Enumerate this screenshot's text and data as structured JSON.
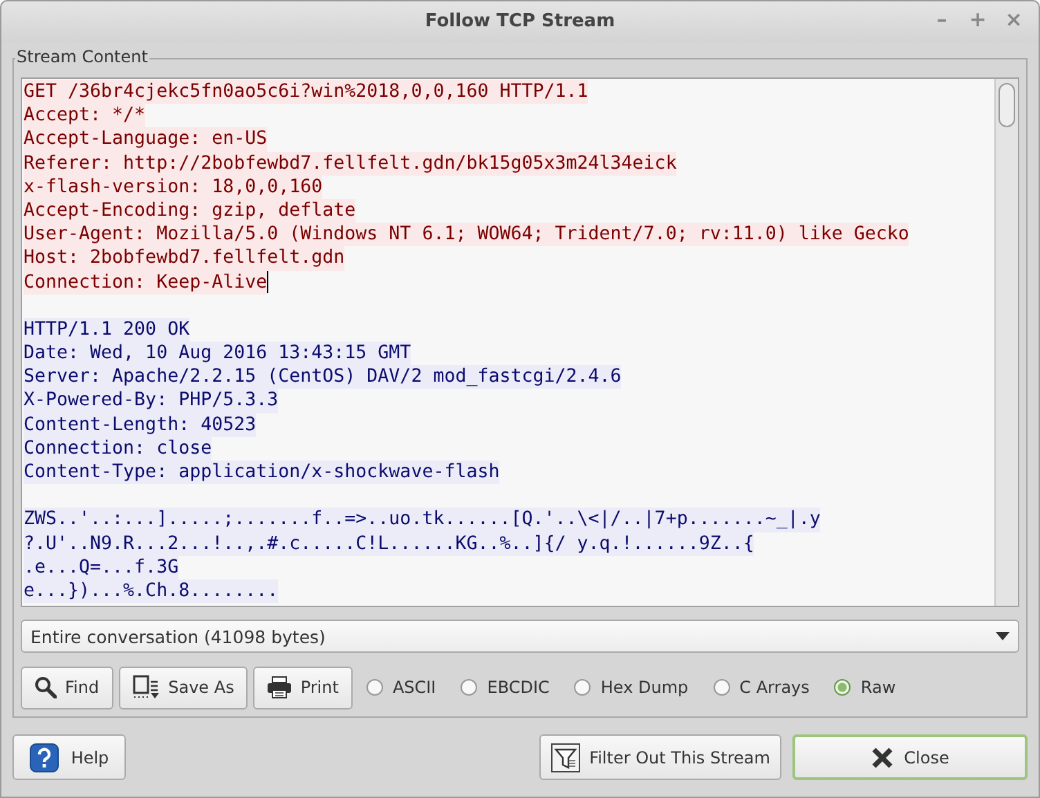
{
  "window": {
    "title": "Follow TCP Stream",
    "controls": [
      "–",
      "+",
      "×"
    ]
  },
  "stream": {
    "label": "Stream Content",
    "blocks": [
      {
        "kind": "client",
        "lines": [
          {
            "text": "GET /36br4cjekc5fn0ao5c6i?win%2018,0,0,160 HTTP/1.1"
          },
          {
            "text": "Accept: */*"
          },
          {
            "text": "Accept-Language: en-US"
          },
          {
            "text": "Referer: http://2bobfewbd7.fellfelt.gdn/bk15g05x3m24l34eick"
          },
          {
            "text": "x-flash-version: 18,0,0,160"
          },
          {
            "text": "Accept-Encoding: gzip, deflate"
          },
          {
            "text": "User-Agent: Mozilla/5.0 (Windows NT 6.1; WOW64; Trident/7.0; rv:11.0) like Gecko"
          },
          {
            "text": "Host: 2bobfewbd7.fellfelt.gdn"
          },
          {
            "text": "Connection: Keep-Alive",
            "cursor": true
          }
        ]
      },
      {
        "kind": "server",
        "lines": [
          {
            "text": "HTTP/1.1 200 OK"
          },
          {
            "text": "Date: Wed, 10 Aug 2016 13:43:15 GMT"
          },
          {
            "text": "Server: Apache/2.2.15 (CentOS) DAV/2 mod_fastcgi/2.4.6"
          },
          {
            "text": "X-Powered-By: PHP/5.3.3"
          },
          {
            "text": "Content-Length: 40523"
          },
          {
            "text": "Connection: close"
          },
          {
            "text": "Content-Type: application/x-shockwave-flash"
          }
        ]
      },
      {
        "kind": "server",
        "lines": [
          {
            "text": "ZWS..'..:...].....;.......f..=>..uo.tk......[Q.'..\\<|/..|7+p.......~_|.y"
          },
          {
            "text": "?.U'..N9.R...2...!..,.#.c.....C!L......KG..%..]{/ y.q.!......9Z..{"
          },
          {
            "text": ".e...Q=...f.3G"
          },
          {
            "text": "e...})...%.Ch.8........"
          }
        ]
      }
    ]
  },
  "conversation": {
    "value": "Entire conversation (41098 bytes)"
  },
  "actions": [
    {
      "kind": "find",
      "label": "Find"
    },
    {
      "kind": "save",
      "label": "Save As"
    },
    {
      "kind": "print",
      "label": "Print"
    }
  ],
  "formats": [
    {
      "label": "ASCII",
      "selected": false
    },
    {
      "label": "EBCDIC",
      "selected": false
    },
    {
      "label": "Hex Dump",
      "selected": false
    },
    {
      "label": "C Arrays",
      "selected": false
    },
    {
      "label": "Raw",
      "selected": true
    }
  ],
  "footer": [
    {
      "kind": "help",
      "label": "Help",
      "default": false
    },
    {
      "kind": "spacer"
    },
    {
      "kind": "filter",
      "label": "Filter Out This Stream",
      "default": false
    },
    {
      "kind": "close",
      "label": "Close",
      "default": true
    }
  ]
}
